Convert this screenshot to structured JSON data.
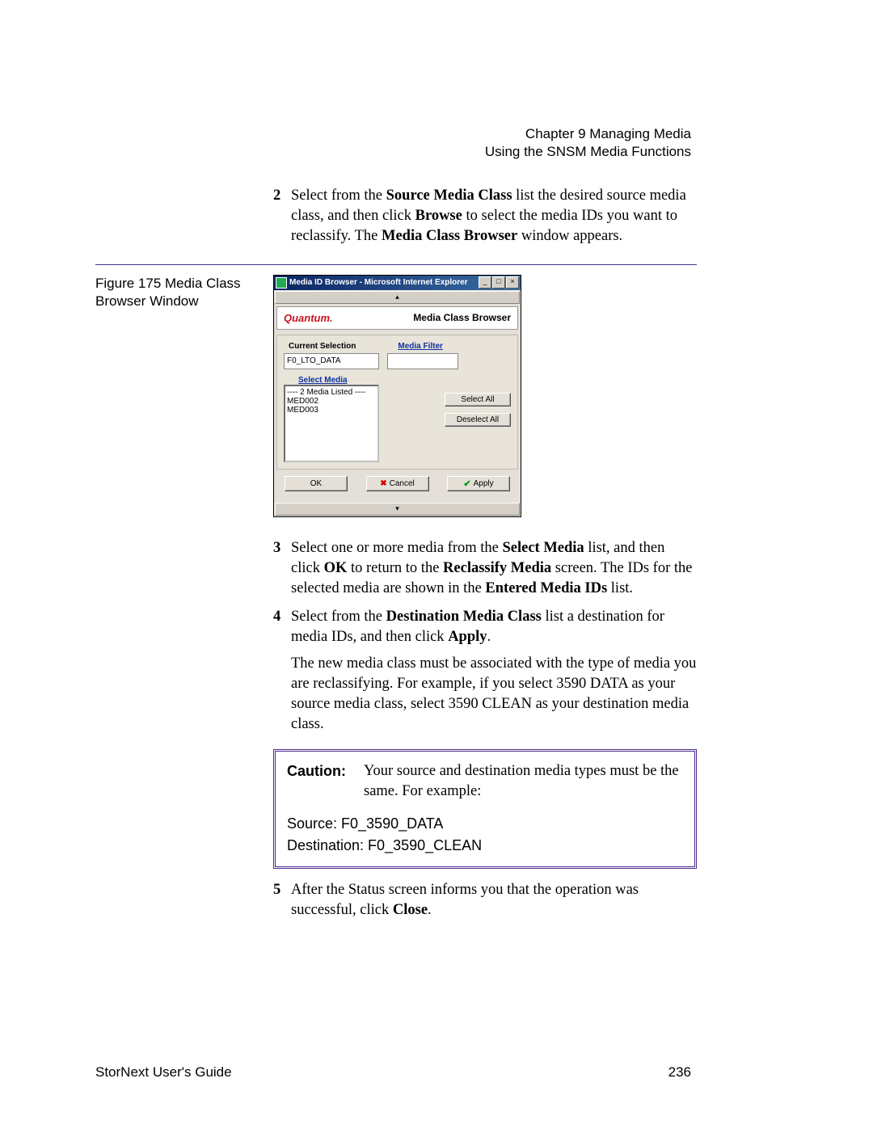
{
  "header": {
    "line1": "Chapter 9  Managing Media",
    "line2": "Using the SNSM Media Functions"
  },
  "figure": {
    "caption": "Figure 175  Media Class Browser Window"
  },
  "dialog": {
    "title": "Media ID Browser - Microsoft Internet Explorer",
    "brand": "Quantum.",
    "brand_title": "Media Class Browser",
    "current_selection_label": "Current Selection",
    "media_filter_label": "Media Filter",
    "current_selection_value": "F0_LTO_DATA",
    "media_filter_value": "",
    "select_media_label": "Select Media",
    "list_header": "---- 2 Media Listed ----",
    "list_items": [
      "MED002",
      "MED003"
    ],
    "select_all": "Select All",
    "deselect_all": "Deselect All",
    "ok": "OK",
    "cancel": "Cancel",
    "apply": "Apply"
  },
  "steps": {
    "s2_num": "2",
    "s2_a": "Select from the ",
    "s2_b": "Source Media Class",
    "s2_c": " list the desired source media class, and then click ",
    "s2_d": "Browse",
    "s2_e": " to select the media IDs you want to reclassify. The ",
    "s2_f": "Media Class Browser",
    "s2_g": " window appears.",
    "s3_num": "3",
    "s3_a": "Select one or more media from the ",
    "s3_b": "Select Media",
    "s3_c": " list, and then click ",
    "s3_d": "OK",
    "s3_e": " to return to the ",
    "s3_f": "Reclassify Media",
    "s3_g": " screen. The IDs for the selected media are shown in the ",
    "s3_h": "Entered Media IDs",
    "s3_i": " list.",
    "s4_num": "4",
    "s4_a": "Select from the ",
    "s4_b": "Destination Media Class",
    "s4_c": " list a destination for media IDs, and then click ",
    "s4_d": "Apply",
    "s4_e": ".",
    "s4_para": "The new media class must be associated with the type of media you are reclassifying. For example, if you select 3590 DATA as your source media class, select 3590 CLEAN as your destination media class.",
    "s5_num": "5",
    "s5_a": "After the Status screen informs you that the operation was successful, click ",
    "s5_b": "Close",
    "s5_c": "."
  },
  "caution": {
    "label": "Caution:",
    "text": "Your source and destination media types must be the same. For example:",
    "source": "Source: F0_3590_DATA",
    "dest": "Destination: F0_3590_CLEAN"
  },
  "footer": {
    "left": "StorNext User's Guide",
    "right": "236"
  }
}
